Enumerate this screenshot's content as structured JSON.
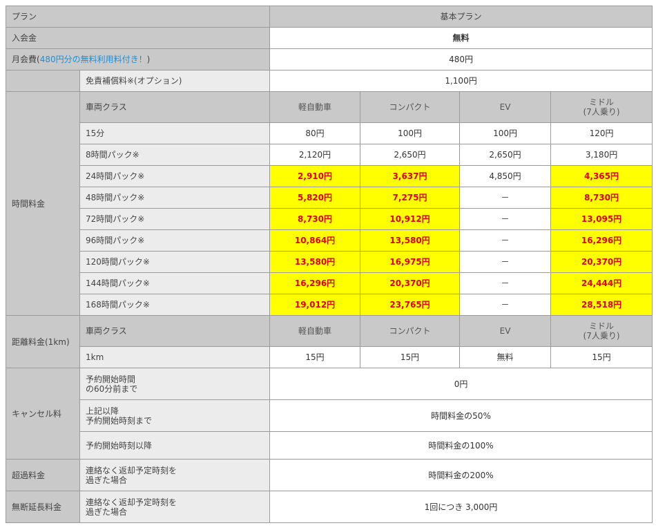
{
  "header": {
    "plan_label": "プラン",
    "basic_plan": "基本プラン"
  },
  "enrollment": {
    "label": "入会金",
    "value": "無料"
  },
  "monthly": {
    "label_pre": "月会費(",
    "label_blue": "480円分の無料利用料付き！",
    "label_post": ")",
    "value": "480円"
  },
  "insurance": {
    "label": "免責補償料※(オプション)",
    "value": "1,100円"
  },
  "time_fee": {
    "section": "時間料金",
    "class_label": "車両クラス",
    "classes": [
      "軽自動車",
      "コンパクト",
      "EV",
      "ミドル\n(7人乗り)"
    ],
    "rows": [
      {
        "label": "15分",
        "values": [
          "80円",
          "100円",
          "100円",
          "120円"
        ]
      },
      {
        "label": "8時間パック※",
        "values": [
          "2,120円",
          "2,650円",
          "2,650円",
          "3,180円"
        ]
      },
      {
        "label": "24時間パック※",
        "values": [
          "2,910円",
          "3,637円",
          "4,850円",
          "4,365円"
        ]
      },
      {
        "label": "48時間パック※",
        "values": [
          "5,820円",
          "7,275円",
          "－",
          "8,730円"
        ]
      },
      {
        "label": "72時間パック※",
        "values": [
          "8,730円",
          "10,912円",
          "－",
          "13,095円"
        ]
      },
      {
        "label": "96時間パック※",
        "values": [
          "10,864円",
          "13,580円",
          "－",
          "16,296円"
        ]
      },
      {
        "label": "120時間パック※",
        "values": [
          "13,580円",
          "16,975円",
          "－",
          "20,370円"
        ]
      },
      {
        "label": "144時間パック※",
        "values": [
          "16,296円",
          "20,370円",
          "－",
          "24,444円"
        ]
      },
      {
        "label": "168時間パック※",
        "values": [
          "19,012円",
          "23,765円",
          "－",
          "28,518円"
        ]
      }
    ]
  },
  "distance_fee": {
    "section": "距離料金(1km)",
    "class_label": "車両クラス",
    "classes": [
      "軽自動車",
      "コンパクト",
      "EV",
      "ミドル\n(7人乗り)"
    ],
    "row": {
      "label": "1km",
      "values": [
        "15円",
        "15円",
        "無料",
        "15円"
      ]
    }
  },
  "cancel": {
    "section": "キャンセル料",
    "rows": [
      {
        "label": "予約開始時間\nの60分前まで",
        "value": "0円"
      },
      {
        "label": "上記以降\n予約開始時刻まで",
        "value": "時間料金の50%"
      },
      {
        "label": "予約開始時刻以降",
        "value": "時間料金の100%"
      }
    ]
  },
  "overtime": {
    "section": "超過料金",
    "label": "連絡なく返却予定時刻を\n過ぎた場合",
    "value": "時間料金の200%"
  },
  "extension": {
    "section": "無断延長料金",
    "label": "連絡なく返却予定時刻を\n過ぎた場合",
    "value": "1回につき 3,000円"
  }
}
